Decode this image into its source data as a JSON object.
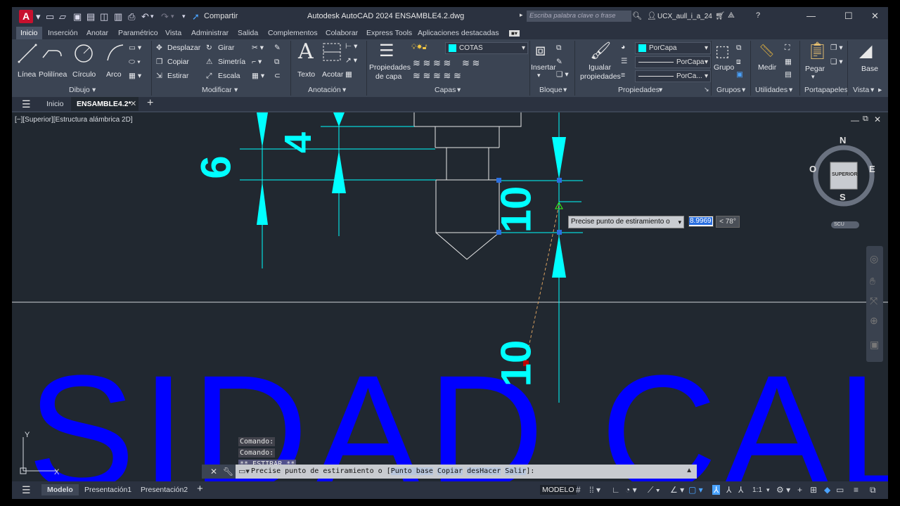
{
  "window": {
    "app_letter": "A",
    "title": "Autodesk AutoCAD 2024    ENSAMBLE4.2.dwg",
    "share_label": "Compartir",
    "search_placeholder": "Escriba palabra clave o frase",
    "user": "UCX_aull_i_a_24"
  },
  "ribbon_tabs": [
    "Inicio",
    "Inserción",
    "Anotar",
    "Paramétrico",
    "Vista",
    "Administrar",
    "Salida",
    "Complementos",
    "Colaborar",
    "Express Tools",
    "Aplicaciones destacadas"
  ],
  "ribbon": {
    "dibujo": {
      "title": "Dibujo",
      "linea": "Línea",
      "polilinea": "Polilínea",
      "circulo": "Círculo",
      "arco": "Arco"
    },
    "modificar": {
      "title": "Modificar",
      "desplazar": "Desplazar",
      "girar": "Girar",
      "copiar": "Copiar",
      "simetria": "Simetría",
      "estirar": "Estirar",
      "escala": "Escala"
    },
    "anotacion": {
      "title": "Anotación",
      "texto": "Texto",
      "acotar": "Acotar"
    },
    "capas": {
      "title": "Capas",
      "propiedades_de": "Propiedades",
      "propiedades_de2": "de capa",
      "layer_combo": "COTAS"
    },
    "bloque": {
      "title": "Bloque",
      "insertar": "Insertar"
    },
    "propiedades": {
      "title": "Propiedades",
      "igualar": "Igualar",
      "igualar2": "propiedades",
      "color": "PorCapa",
      "linetype": "PorCapa",
      "lineweight": "PorCa..."
    },
    "grupos": {
      "title": "Grupos",
      "grupo": "Grupo"
    },
    "utilidades": {
      "title": "Utilidades",
      "medir": "Medir"
    },
    "portapapeles": {
      "title": "Portapapeles",
      "pegar": "Pegar"
    },
    "vista": {
      "title": "Vista",
      "base": "Base"
    }
  },
  "file_tabs": {
    "inicio": "Inicio",
    "active": "ENSAMBLE4.2*"
  },
  "viewport": {
    "label": "[−][Superior][Estructura alámbrica 2D]",
    "dims": [
      "6",
      "4",
      "10",
      "10"
    ],
    "big_text": "SIDAD CALM",
    "viewcube": {
      "n": "N",
      "s": "S",
      "e": "E",
      "w": "O",
      "face": "SUPERIOR",
      "scu": "SCU"
    }
  },
  "dynamic_input": {
    "prompt": "Precise punto de estiramiento o",
    "value": "8.9969",
    "angle": "< 78°"
  },
  "command_history": [
    "Comando:",
    "Comando:",
    "** ESTIRAR **"
  ],
  "command_line": {
    "prefix": "Precise punto de estiramiento o [",
    "options": [
      "Punto base",
      "Copiar",
      "desHacer",
      "Salir"
    ],
    "suffix": "]:"
  },
  "status_bar": {
    "tabs": [
      "Modelo",
      "Presentación1",
      "Presentación2"
    ],
    "mode": "MODELO",
    "scale": "1:1"
  },
  "colors": {
    "dims": "#00ffff",
    "big_text": "#0000ff",
    "canvas": "#212830"
  }
}
